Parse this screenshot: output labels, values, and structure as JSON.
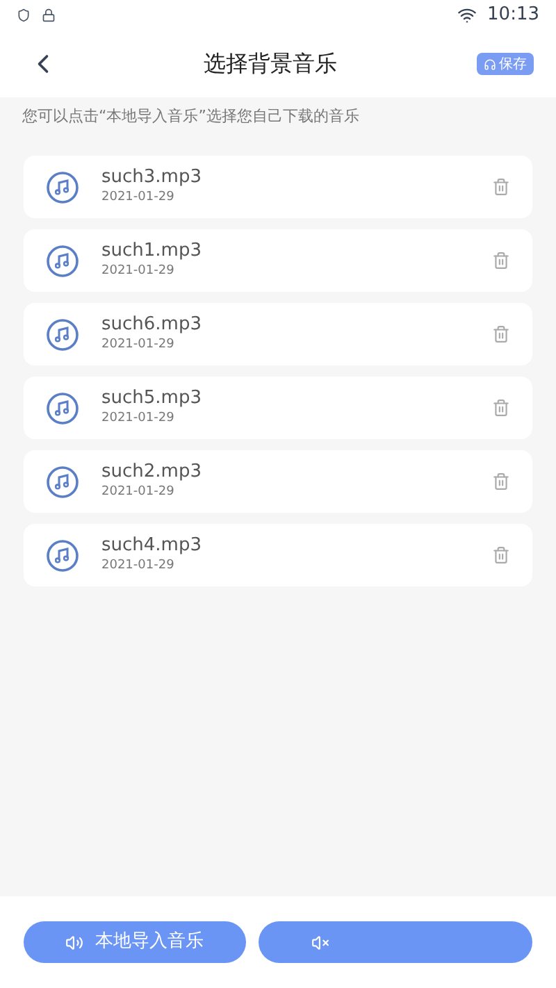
{
  "status_bar": {
    "time": "10:13"
  },
  "header": {
    "title": "选择背景音乐",
    "save_button": "保存"
  },
  "hint": "您可以点击“本地导入音乐”选择您自己下载的音乐",
  "tracks": [
    {
      "name": "such3.mp3",
      "date": "2021-01-29"
    },
    {
      "name": "such1.mp3",
      "date": "2021-01-29"
    },
    {
      "name": "such6.mp3",
      "date": "2021-01-29"
    },
    {
      "name": "such5.mp3",
      "date": "2021-01-29"
    },
    {
      "name": "such2.mp3",
      "date": "2021-01-29"
    },
    {
      "name": "such4.mp3",
      "date": "2021-01-29"
    }
  ],
  "bottom_buttons": [
    {
      "kind": "import",
      "label": "本地导入音乐"
    },
    {
      "kind": "mute"
    }
  ]
}
